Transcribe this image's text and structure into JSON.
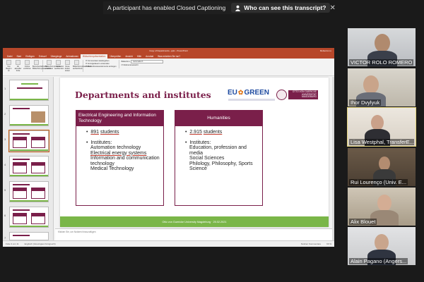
{
  "caption_notice": {
    "message": "A participant has enabled Closed Captioning",
    "button_label": "Who can see this transcript?",
    "close_glyph": "✕"
  },
  "ppt": {
    "window_title": "Copy of Departments...pptx - PowerPoint",
    "user": "Rebecca Lu",
    "tabs": [
      "Datei",
      "Start",
      "Einfügen",
      "Entwurf",
      "Übergänge",
      "Animationen",
      "Bildschirmpräsentation",
      "Überprüfen",
      "Ansicht",
      "Hilfe",
      "Acrobat",
      "Was möchten Sie tun?"
    ],
    "active_tab": "Bildschirmpräsentation",
    "ribbon_buttons": [
      "Von Beginn an",
      "Ab aktueller Folie",
      "Online vorführen",
      "Benutzerdefinierte Bildschirmpräsentation",
      "Bildschirmpräsentation einrichten",
      "Folie ausblenden",
      "Neue Zeiten testen",
      "Bildschirmpräsentation aufzeichnen"
    ],
    "ribbon_checks": [
      "Kommentare wiedergeben",
      "Anzeigedauern verwenden",
      "Medienbesteuerelemente anzeigen"
    ],
    "monitor_label": "Bildschirm:",
    "monitor_value": "Automatisch",
    "presenter_check": "Referentenansicht",
    "thumb_numbers": [
      "1",
      "2",
      "3",
      "4",
      "5",
      "6",
      "7"
    ],
    "notes_placeholder": "Klicken Sie, um Notizen hinzuzufügen",
    "status_left": "Folie 3 von 11",
    "status_lang": "Englisch (Vereinigtes Königreich)",
    "status_right": "Notizen   Kommentare",
    "zoom": "69 %"
  },
  "slide": {
    "title": "Departments and institutes",
    "logo_eu": "EU",
    "logo_green": "GREEN",
    "logo_ovgu": "OTTO VON GUERICKE UNIVERSITÄT MAGDEBURG",
    "footer": "Otto von Guericke University Magdeburg · 25.02.2021",
    "departments": [
      {
        "heading": "Electrical Engineering and Information Technology",
        "students_count": "891",
        "students_word": "students",
        "institutes_label": "Institutes:",
        "institutes": [
          "Automation technology",
          "Electrical energy systems",
          "Information and communication technology",
          "Medical Technology"
        ]
      },
      {
        "heading": "Humanities",
        "students_count": "2.915",
        "students_word": "students",
        "institutes_label": "Institutes:",
        "institutes": [
          "Education, profession and media",
          "Social Sciences",
          "Philology, Philosophy, Sports Science"
        ]
      }
    ]
  },
  "participants": [
    {
      "name": "VICTOR ROLO ROMERO"
    },
    {
      "name": "Ihor Dvylyuk"
    },
    {
      "name": "Lisa Westphal, TransferE..."
    },
    {
      "name": "Rui Lourenço (Univ. E..."
    },
    {
      "name": "Alix Blouet"
    },
    {
      "name": "Alain Pagano (Angers..."
    }
  ],
  "colors": {
    "ovgu_plum": "#7a1f4a",
    "footer_green": "#7ab648",
    "ppt_red": "#b7472a",
    "active_speaker": "#e2d27a"
  }
}
